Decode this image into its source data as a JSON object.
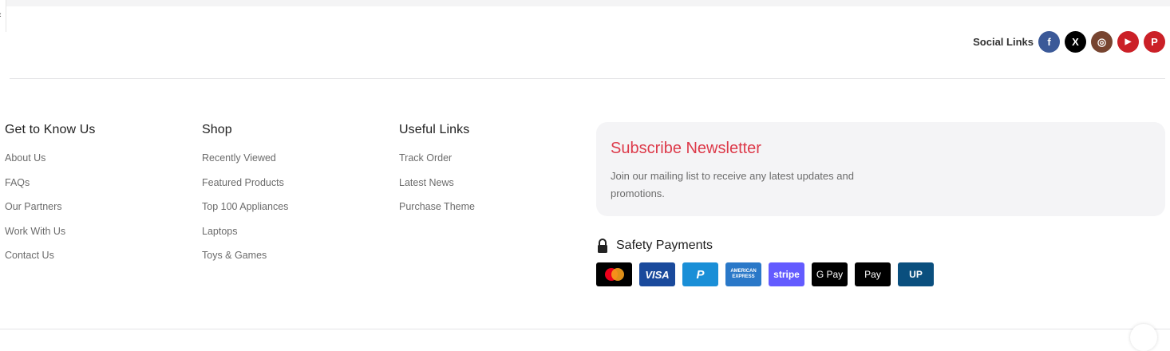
{
  "social": {
    "label": "Social Links",
    "icons": [
      {
        "name": "facebook-icon",
        "glyph": "f",
        "color": "#3b5998"
      },
      {
        "name": "x-icon",
        "glyph": "X",
        "color": "#000000"
      },
      {
        "name": "instagram-icon",
        "glyph": "◎",
        "color": "#774430"
      },
      {
        "name": "youtube-icon",
        "glyph": "▶",
        "color": "#cb2027"
      },
      {
        "name": "pinterest-icon",
        "glyph": "P",
        "color": "#cb2027"
      }
    ]
  },
  "columns": [
    {
      "title": "Get to Know Us",
      "links": [
        "About Us",
        "FAQs",
        "Our Partners",
        "Work With Us",
        "Contact Us"
      ]
    },
    {
      "title": "Shop",
      "links": [
        "Recently Viewed",
        "Featured Products",
        "Top 100 Appliances",
        "Laptops",
        "Toys & Games"
      ]
    },
    {
      "title": "Useful Links",
      "links": [
        "Track Order",
        "Latest News",
        "Purchase Theme"
      ]
    }
  ],
  "newsletter": {
    "title": "Subscribe Newsletter",
    "text": "Join our mailing list to receive any latest updates and promotions."
  },
  "payments": {
    "title": "Safety Payments",
    "cards": [
      {
        "name": "mastercard-icon",
        "label": "",
        "color": "#000000"
      },
      {
        "name": "visa-icon",
        "label": "VISA",
        "color": "#1a4a9c"
      },
      {
        "name": "paypal-icon",
        "label": "P",
        "color": "#1a8fd7"
      },
      {
        "name": "amex-icon",
        "label": "AMERICAN EXPRESS",
        "color": "#2a78c8"
      },
      {
        "name": "stripe-icon",
        "label": "stripe",
        "color": "#635bff"
      },
      {
        "name": "google-pay-icon",
        "label": "G Pay",
        "color": "#000000"
      },
      {
        "name": "apple-pay-icon",
        "label": " Pay",
        "color": "#000000"
      },
      {
        "name": "unionpay-icon",
        "label": "UP",
        "color": "#0a4f7e"
      }
    ]
  }
}
